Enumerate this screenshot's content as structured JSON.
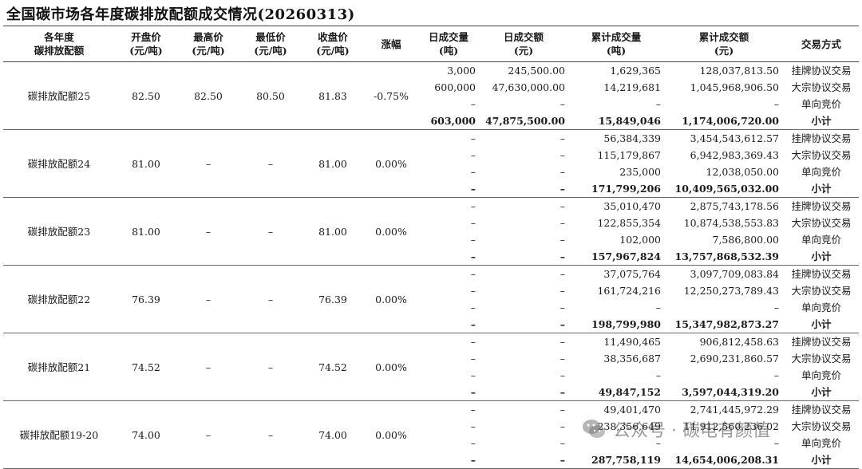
{
  "title": "全国碳市场各年度碳排放配额成交情况(20260313)",
  "headers": {
    "product": [
      "各年度",
      "碳排放配额"
    ],
    "open": [
      "开盘价",
      "(元/吨)"
    ],
    "high": [
      "最高价",
      "(元/吨)"
    ],
    "low": [
      "最低价",
      "(元/吨)"
    ],
    "close": [
      "收盘价",
      "(元/吨)"
    ],
    "change": [
      "涨幅",
      ""
    ],
    "daily_volume": [
      "日成交量",
      "(吨)"
    ],
    "daily_amount": [
      "日成交额",
      "(元)"
    ],
    "cum_volume": [
      "累计成交量",
      "(吨)"
    ],
    "cum_amount": [
      "累计成交额",
      "(元)"
    ],
    "method": [
      "交易方式",
      ""
    ]
  },
  "groups": [
    {
      "name": "碳排放配额25",
      "open": "82.50",
      "high": "82.50",
      "low": "80.50",
      "close": "81.83",
      "change": "-0.75%",
      "rows": [
        {
          "dv": "3,000",
          "da": "245,500.00",
          "cv": "1,629,365",
          "ca": "128,037,813.50",
          "m": "挂牌协议交易"
        },
        {
          "dv": "600,000",
          "da": "47,630,000.00",
          "cv": "14,219,681",
          "ca": "1,045,968,906.50",
          "m": "大宗协议交易"
        },
        {
          "dv": "–",
          "da": "–",
          "cv": "–",
          "ca": "–",
          "m": "单向竞价"
        },
        {
          "dv": "603,000",
          "da": "47,875,500.00",
          "cv": "15,849,046",
          "ca": "1,174,006,720.00",
          "m": "小计"
        }
      ]
    },
    {
      "name": "碳排放配额24",
      "open": "81.00",
      "high": "–",
      "low": "–",
      "close": "81.00",
      "change": "0.00%",
      "rows": [
        {
          "dv": "–",
          "da": "–",
          "cv": "56,384,339",
          "ca": "3,454,543,612.57",
          "m": "挂牌协议交易"
        },
        {
          "dv": "–",
          "da": "–",
          "cv": "115,179,867",
          "ca": "6,942,983,369.43",
          "m": "大宗协议交易"
        },
        {
          "dv": "–",
          "da": "–",
          "cv": "235,000",
          "ca": "12,038,050.00",
          "m": "单向竞价"
        },
        {
          "dv": "–",
          "da": "–",
          "cv": "171,799,206",
          "ca": "10,409,565,032.00",
          "m": "小计"
        }
      ]
    },
    {
      "name": "碳排放配额23",
      "open": "81.00",
      "high": "–",
      "low": "–",
      "close": "81.00",
      "change": "0.00%",
      "rows": [
        {
          "dv": "–",
          "da": "–",
          "cv": "35,010,470",
          "ca": "2,875,743,178.56",
          "m": "挂牌协议交易"
        },
        {
          "dv": "–",
          "da": "–",
          "cv": "122,855,354",
          "ca": "10,874,538,553.83",
          "m": "大宗协议交易"
        },
        {
          "dv": "–",
          "da": "–",
          "cv": "102,000",
          "ca": "7,586,800.00",
          "m": "单向竞价"
        },
        {
          "dv": "–",
          "da": "–",
          "cv": "157,967,824",
          "ca": "13,757,868,532.39",
          "m": "小计"
        }
      ]
    },
    {
      "name": "碳排放配额22",
      "open": "76.39",
      "high": "–",
      "low": "–",
      "close": "76.39",
      "change": "0.00%",
      "rows": [
        {
          "dv": "–",
          "da": "–",
          "cv": "37,075,764",
          "ca": "3,097,709,083.84",
          "m": "挂牌协议交易"
        },
        {
          "dv": "–",
          "da": "–",
          "cv": "161,724,216",
          "ca": "12,250,273,789.43",
          "m": "大宗协议交易"
        },
        {
          "dv": "–",
          "da": "–",
          "cv": "–",
          "ca": "–",
          "m": "单向竞价"
        },
        {
          "dv": "–",
          "da": "–",
          "cv": "198,799,980",
          "ca": "15,347,982,873.27",
          "m": "小计"
        }
      ]
    },
    {
      "name": "碳排放配额21",
      "open": "74.52",
      "high": "–",
      "low": "–",
      "close": "74.52",
      "change": "0.00%",
      "rows": [
        {
          "dv": "–",
          "da": "–",
          "cv": "11,490,465",
          "ca": "906,812,458.63",
          "m": "挂牌协议交易"
        },
        {
          "dv": "–",
          "da": "–",
          "cv": "38,356,687",
          "ca": "2,690,231,860.57",
          "m": "大宗协议交易"
        },
        {
          "dv": "–",
          "da": "–",
          "cv": "–",
          "ca": "–",
          "m": "单向竞价"
        },
        {
          "dv": "–",
          "da": "–",
          "cv": "49,847,152",
          "ca": "3,597,044,319.20",
          "m": "小计"
        }
      ]
    },
    {
      "name": "碳排放配额19-20",
      "open": "74.00",
      "high": "–",
      "low": "–",
      "close": "74.00",
      "change": "0.00%",
      "rows": [
        {
          "dv": "–",
          "da": "–",
          "cv": "49,401,470",
          "ca": "2,741,445,972.29",
          "m": "挂牌协议交易"
        },
        {
          "dv": "–",
          "da": "–",
          "cv": "238,356,649",
          "ca": "11,912,560,236.02",
          "m": "大宗协议交易"
        },
        {
          "dv": "–",
          "da": "–",
          "cv": "–",
          "ca": "–",
          "m": "单向竞价"
        },
        {
          "dv": "–",
          "da": "–",
          "cv": "287,758,119",
          "ca": "14,654,006,208.31",
          "m": "小计"
        }
      ]
    }
  ],
  "watermark": {
    "text": "公众号 · 碳电有颜值",
    "icon": "wechat-icon"
  }
}
